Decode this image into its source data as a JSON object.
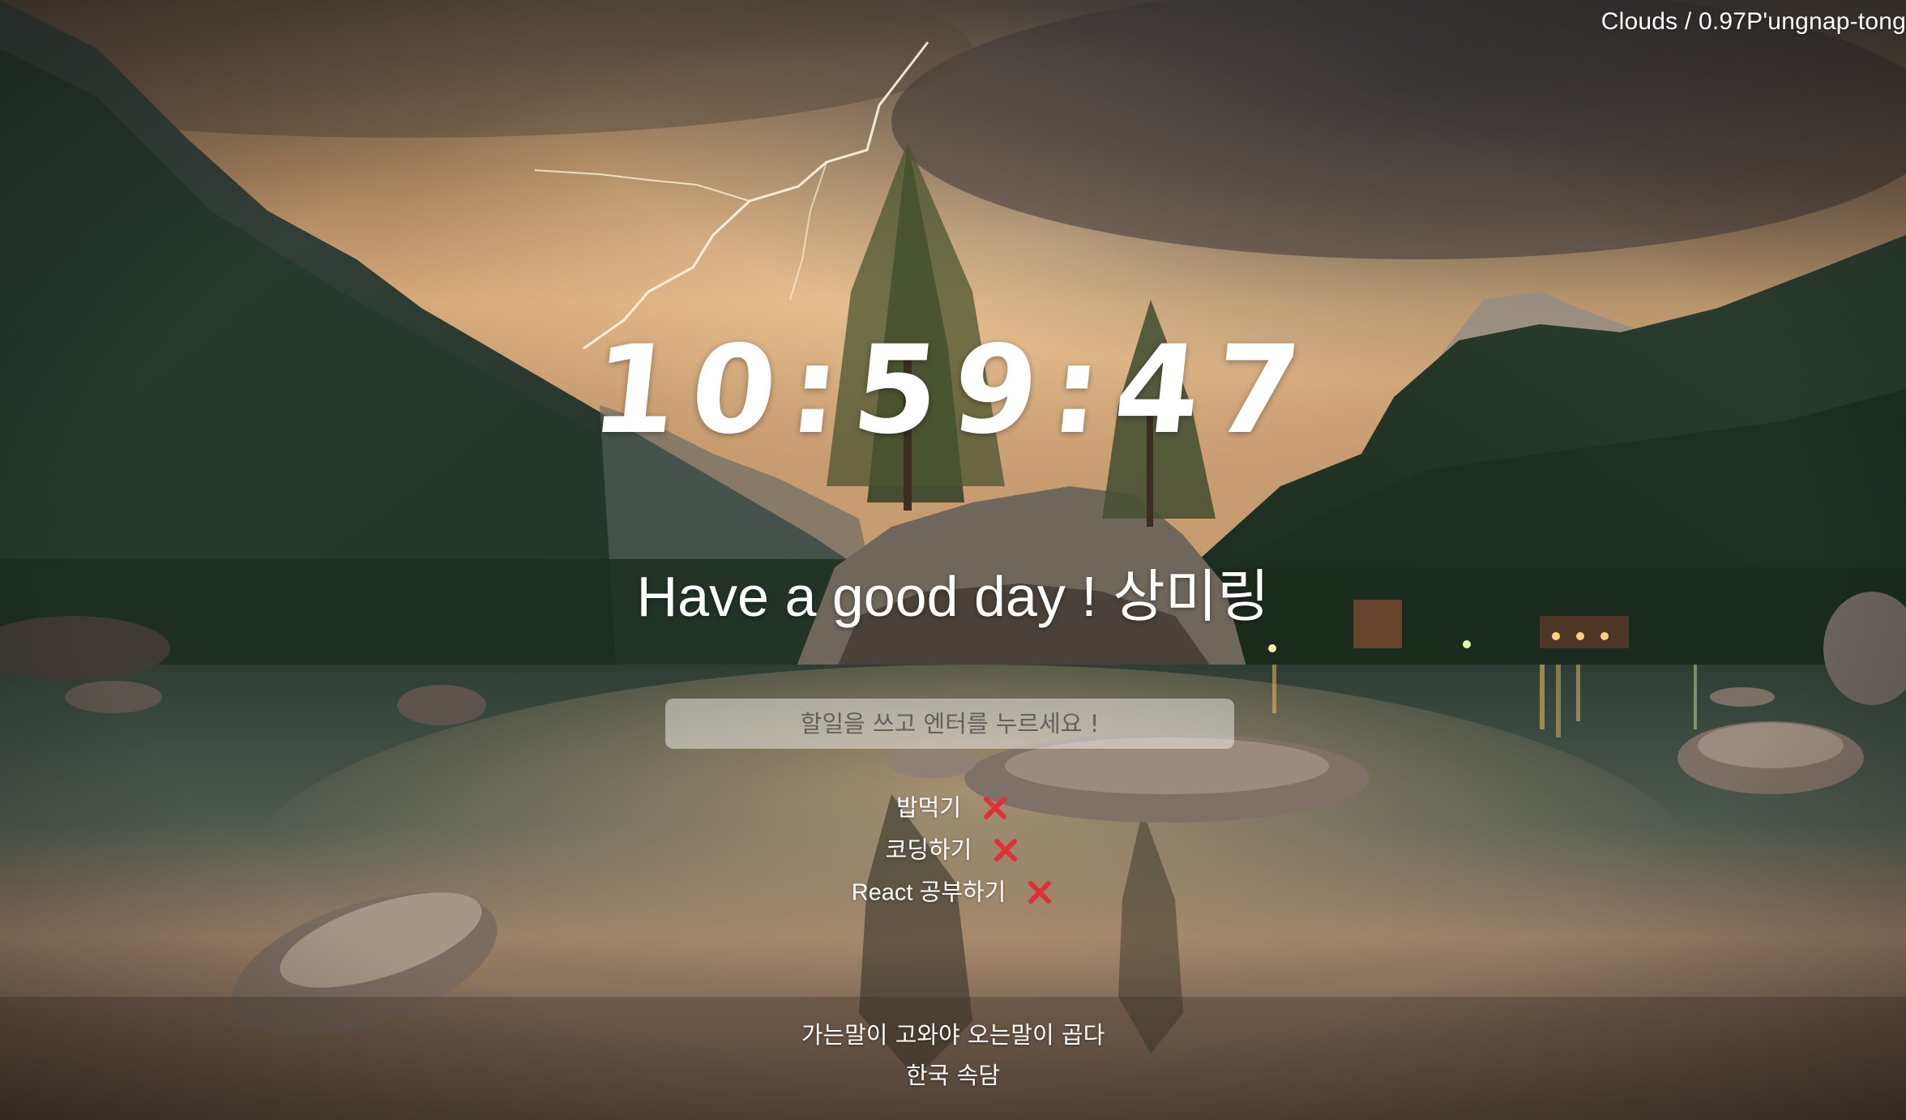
{
  "weather": {
    "text": "Clouds / 0.97P'ungnap-tong"
  },
  "clock": {
    "time": "10:59:47"
  },
  "greeting": {
    "text": "Have a good day ! 상미링"
  },
  "todo": {
    "placeholder": "할일을 쓰고 엔터를 누르세요 !",
    "value": "",
    "items": [
      {
        "label": "밥먹기",
        "delete_icon": "red-x-icon"
      },
      {
        "label": "코딩하기",
        "delete_icon": "red-x-icon"
      },
      {
        "label": "React 공부하기",
        "delete_icon": "red-x-icon"
      }
    ]
  },
  "quote": {
    "text": "가는말이 고와야 오는말이 곱다",
    "author": "한국 속담"
  },
  "colors": {
    "delete_icon": "#e0303a",
    "input_background": "rgba(255,255,255,0.45)"
  },
  "background": {
    "description_icon": "mountain-lake-storm-background"
  }
}
